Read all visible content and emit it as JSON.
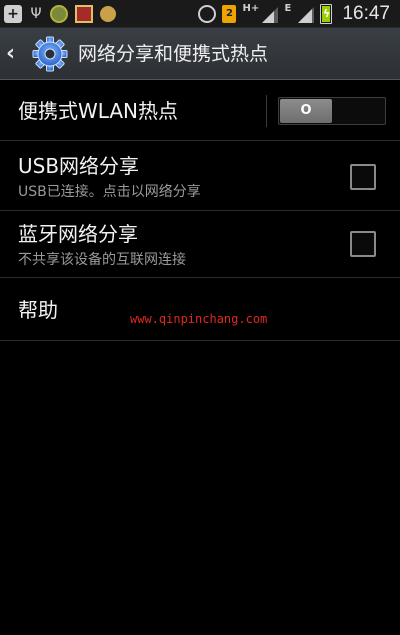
{
  "status_bar": {
    "left_icons": [
      "add-icon",
      "usb-icon",
      "app-icon",
      "app-icon",
      "app-icon"
    ],
    "right_icons": [
      "alarm-icon",
      "sim-icon",
      "network-hplus-icon",
      "signal-icon",
      "network-e-icon",
      "battery-charging-icon"
    ],
    "network_hplus": "H+",
    "network_e": "E",
    "time": "16:47"
  },
  "action_bar": {
    "title": "网络分享和便携式热点"
  },
  "settings": {
    "hotspot": {
      "label": "便携式WLAN热点",
      "toggle_state": "off",
      "toggle_text": "O"
    },
    "usb_tethering": {
      "label": "USB网络分享",
      "summary": "USB已连接。点击以网络分享",
      "checked": false
    },
    "bluetooth_tethering": {
      "label": "蓝牙网络分享",
      "summary": "不共享该设备的互联网连接",
      "checked": false
    },
    "help": {
      "label": "帮助"
    }
  },
  "watermark": "www.qinpinchang.com",
  "colors": {
    "background": "#000000",
    "action_bar": "#33373c",
    "watermark": "#e0281f",
    "battery_fill": "#9ad000"
  }
}
